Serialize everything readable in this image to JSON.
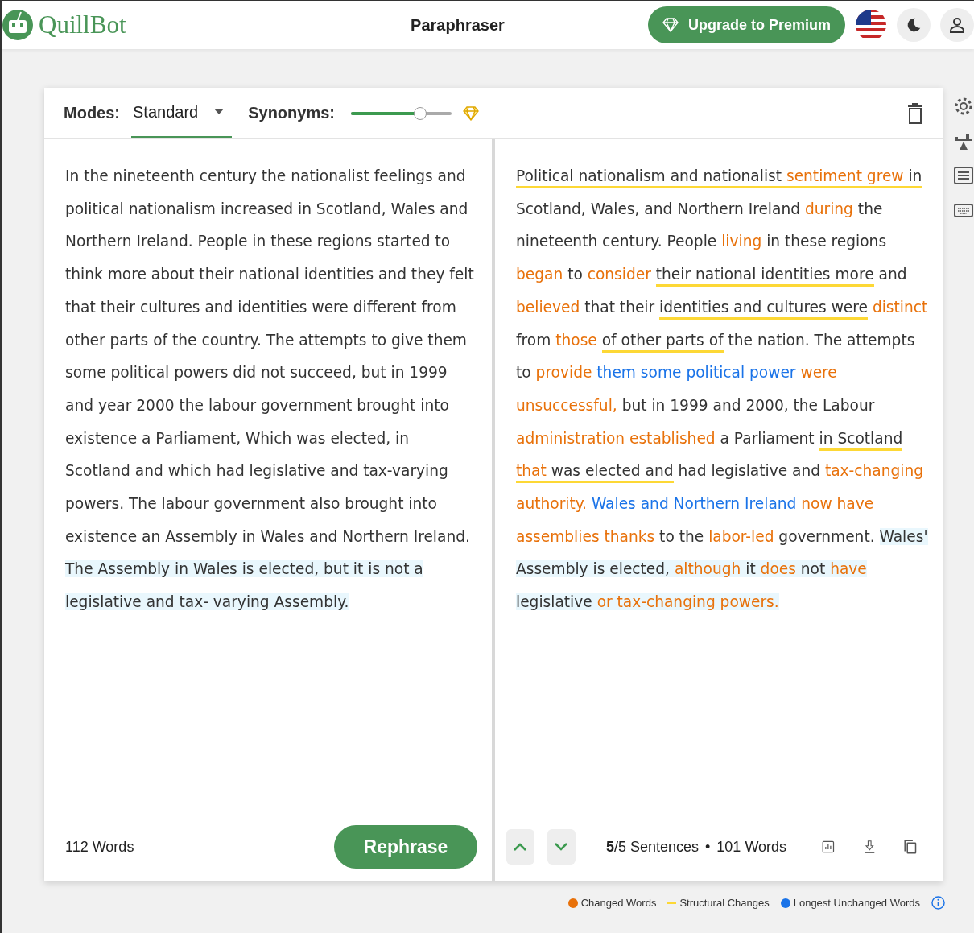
{
  "header": {
    "logo_text": "QuillBot",
    "title": "Paraphraser",
    "upgrade_button": "Upgrade to Premium"
  },
  "toolbar": {
    "modes_label": "Modes:",
    "mode": "Standard",
    "synonyms_label": "Synonyms:",
    "synonyms": {
      "level": 0.69
    }
  },
  "input": {
    "sentences": [
      {
        "text": "In the nineteenth century the nationalist feelings and political nationalism increased in Scotland, Wales and Northern Ireland.",
        "selected": false
      },
      {
        "text": "People in these regions started to think more about their national identities and they felt that their cultures and identities were different from other parts of the country.",
        "selected": false
      },
      {
        "text": "The attempts to give them some political powers did not succeed, but in 1999 and year 2000 the labour government brought into existence a Parliament, Which was elected, in Scotland and which had legislative and tax-varying powers.",
        "selected": false
      },
      {
        "text": "The labour government also brought into existence an Assembly in Wales and Northern Ireland.",
        "selected": false
      },
      {
        "text": "The Assembly in Wales is elected, but it is not a legislative and tax- varying Assembly.",
        "selected": true
      }
    ],
    "word_count": "112 Words",
    "rephrase_button": "Rephrase"
  },
  "output": {
    "sentences": [
      {
        "selected": false,
        "segments": [
          {
            "text": "Political nationalism and nationalist ",
            "kind": "plain",
            "structural": true
          },
          {
            "text": "sentiment grew",
            "kind": "changed",
            "structural": true
          },
          {
            "text": " in",
            "kind": "plain",
            "structural": true
          },
          {
            "text": " Scotland, Wales, and Northern Ireland ",
            "kind": "plain",
            "structural": false
          },
          {
            "text": "during",
            "kind": "changed",
            "structural": false
          },
          {
            "text": " the nineteenth century.",
            "kind": "plain",
            "structural": false
          }
        ]
      },
      {
        "selected": false,
        "segments": [
          {
            "text": "People ",
            "kind": "plain",
            "structural": false
          },
          {
            "text": "living",
            "kind": "changed",
            "structural": false
          },
          {
            "text": " in these regions ",
            "kind": "plain",
            "structural": false
          },
          {
            "text": "began",
            "kind": "changed",
            "structural": false
          },
          {
            "text": " to ",
            "kind": "plain",
            "structural": false
          },
          {
            "text": "consider ",
            "kind": "changed",
            "structural": false
          },
          {
            "text": "their national identities more",
            "kind": "plain",
            "structural": true
          },
          {
            "text": " and ",
            "kind": "plain",
            "structural": false
          },
          {
            "text": "believed",
            "kind": "changed",
            "structural": false
          },
          {
            "text": " that their ",
            "kind": "plain",
            "structural": false
          },
          {
            "text": "identities and cultures were",
            "kind": "plain",
            "structural": true
          },
          {
            "text": " distinct",
            "kind": "changed",
            "structural": false
          },
          {
            "text": " from ",
            "kind": "plain",
            "structural": false
          },
          {
            "text": "those ",
            "kind": "changed",
            "structural": false
          },
          {
            "text": "of other parts of",
            "kind": "plain",
            "structural": true
          },
          {
            "text": " the nation.",
            "kind": "plain",
            "structural": false
          }
        ]
      },
      {
        "selected": false,
        "segments": [
          {
            "text": "The attempts to ",
            "kind": "plain",
            "structural": false
          },
          {
            "text": "provide",
            "kind": "changed",
            "structural": false
          },
          {
            "text": " them some political power",
            "kind": "unchanged",
            "structural": false
          },
          {
            "text": " were unsuccessful,",
            "kind": "changed",
            "structural": false
          },
          {
            "text": " but in 1999 and 2000, the Labour ",
            "kind": "plain",
            "structural": false
          },
          {
            "text": "administration established",
            "kind": "changed",
            "structural": false
          },
          {
            "text": " a Parliament ",
            "kind": "plain",
            "structural": false
          },
          {
            "text": "in Scotland ",
            "kind": "plain",
            "structural": true
          },
          {
            "text": "that",
            "kind": "changed",
            "structural": true
          },
          {
            "text": " was elected and",
            "kind": "plain",
            "structural": true
          },
          {
            "text": " had legislative and ",
            "kind": "plain",
            "structural": false
          },
          {
            "text": "tax-changing authority.",
            "kind": "changed",
            "structural": false
          }
        ]
      },
      {
        "selected": false,
        "segments": [
          {
            "text": "Wales and Northern Ireland",
            "kind": "unchanged",
            "structural": false
          },
          {
            "text": " now have assemblies thanks",
            "kind": "changed",
            "structural": false
          },
          {
            "text": " to the ",
            "kind": "plain",
            "structural": false
          },
          {
            "text": "labor-led",
            "kind": "changed",
            "structural": false
          },
          {
            "text": " government.",
            "kind": "plain",
            "structural": false
          }
        ]
      },
      {
        "selected": true,
        "segments": [
          {
            "text": "Wales' Assembly is elected, ",
            "kind": "plain",
            "structural": false
          },
          {
            "text": "although",
            "kind": "changed",
            "structural": false
          },
          {
            "text": " it ",
            "kind": "plain",
            "structural": false
          },
          {
            "text": "does",
            "kind": "changed",
            "structural": false
          },
          {
            "text": " not ",
            "kind": "plain",
            "structural": false
          },
          {
            "text": "have",
            "kind": "changed",
            "structural": false
          },
          {
            "text": " legislative ",
            "kind": "plain",
            "structural": false
          },
          {
            "text": "or tax-changing powers.",
            "kind": "changed",
            "structural": false
          }
        ]
      }
    ],
    "sentence_count": "**5**/5 Sentences",
    "separator": "•",
    "word_count": "101 Words"
  },
  "legend": [
    {
      "label": "Changed Words",
      "kind": "dot",
      "color": "#e8710a"
    },
    {
      "label": "Structural Changes",
      "kind": "line",
      "color": "#fdd835"
    },
    {
      "label": "Longest Unchanged Words",
      "kind": "dot",
      "color": "#1a73e8"
    }
  ]
}
